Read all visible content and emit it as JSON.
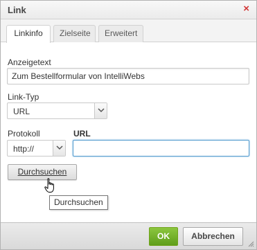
{
  "dialog": {
    "title": "Link",
    "close_symbol": "×"
  },
  "tabs": [
    {
      "label": "Linkinfo",
      "active": true
    },
    {
      "label": "Zielseite",
      "active": false
    },
    {
      "label": "Erweitert",
      "active": false
    }
  ],
  "form": {
    "display_text_label": "Anzeigetext",
    "display_text_value": "Zum Bestellformular von IntelliWebs",
    "link_type_label": "Link-Typ",
    "link_type_value": "URL",
    "protocol_label": "Protokoll",
    "protocol_value": "http://",
    "url_label": "URL",
    "url_value": "",
    "browse_label": "Durchsuchen"
  },
  "tooltip": {
    "text": "Durchsuchen"
  },
  "footer": {
    "ok_label": "OK",
    "cancel_label": "Abbrechen"
  },
  "colors": {
    "ok_green": "#6fb21f",
    "close_red": "#d13636",
    "focus_blue": "#549ccf"
  },
  "icons": [
    "close-icon",
    "chevron-down-icon",
    "hand-cursor-icon",
    "resize-grip-icon"
  ]
}
